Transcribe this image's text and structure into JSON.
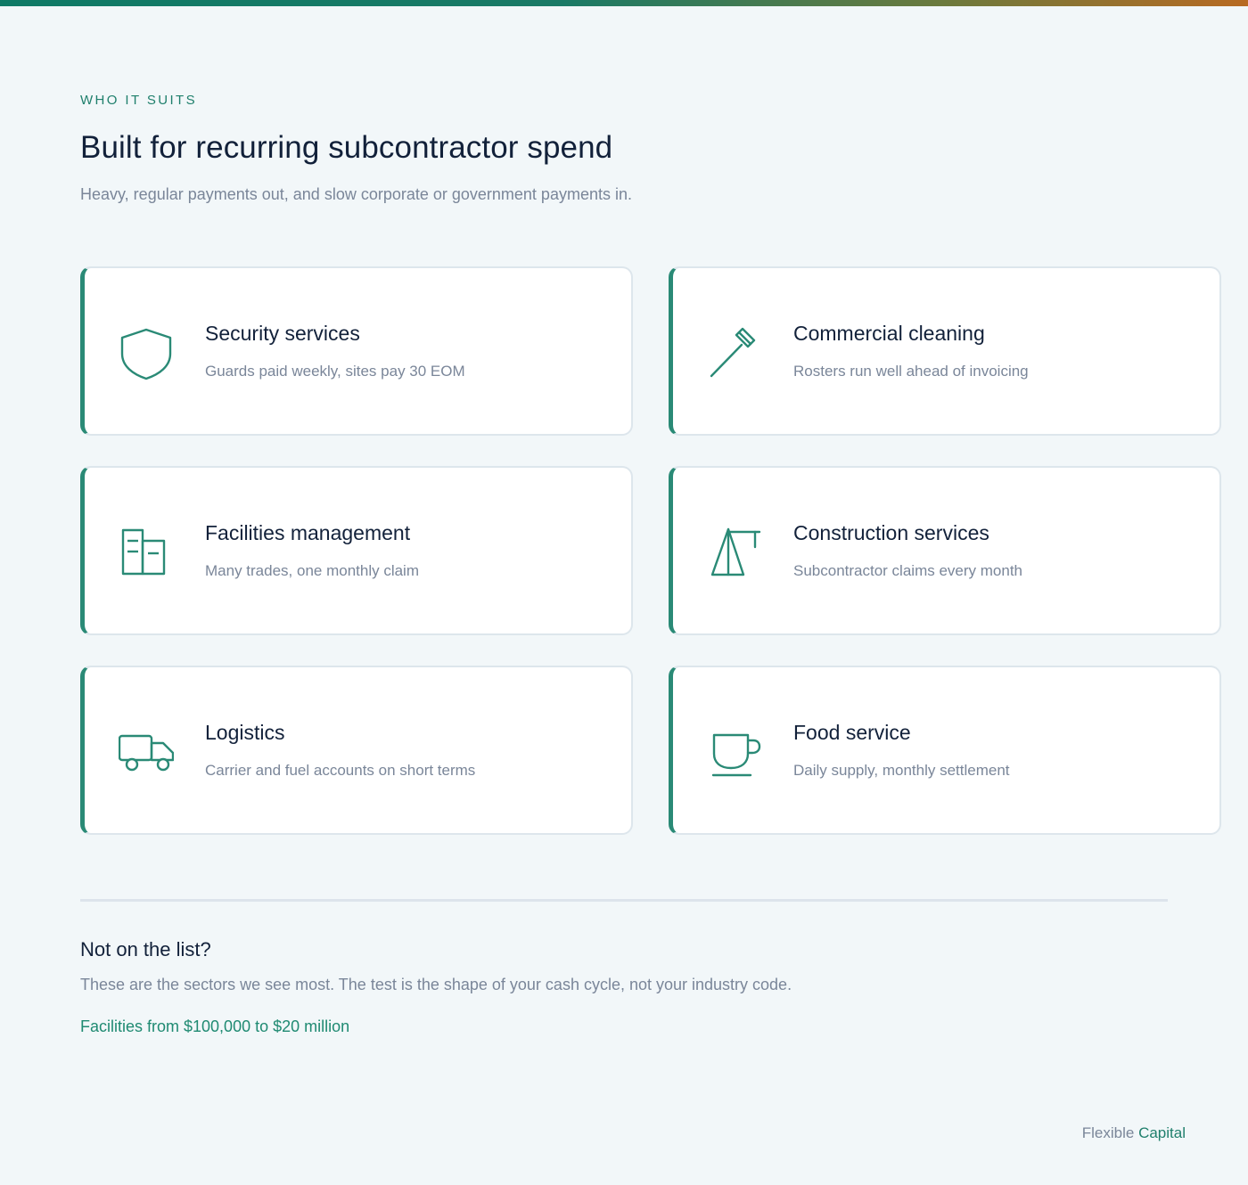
{
  "eyebrow": "WHO IT SUITS",
  "title": "Built for recurring subcontractor spend",
  "subtitle": "Heavy, regular payments out, and slow corporate or government payments in.",
  "cards": [
    {
      "title": "Security services",
      "desc": "Guards paid weekly, sites pay 30 EOM",
      "icon": "shield-icon"
    },
    {
      "title": "Commercial cleaning",
      "desc": "Rosters run well ahead of invoicing",
      "icon": "mop-icon"
    },
    {
      "title": "Facilities management",
      "desc": "Many trades, one monthly claim",
      "icon": "building-icon"
    },
    {
      "title": "Construction services",
      "desc": "Subcontractor claims every month",
      "icon": "crane-icon"
    },
    {
      "title": "Logistics",
      "desc": "Carrier and fuel accounts on short terms",
      "icon": "truck-icon"
    },
    {
      "title": "Food service",
      "desc": "Daily supply, monthly settlement",
      "icon": "cup-icon"
    }
  ],
  "not_on_list": {
    "title": "Not on the list?",
    "text": "These are the sectors we see most. The test is the shape of your cash cycle, not your industry code.",
    "facilities": "Facilities from $100,000 to $20 million"
  },
  "brand": {
    "part1": "Flexible",
    "part2": "Capital"
  },
  "colors": {
    "accent": "#2a8a76",
    "heading": "#12213a",
    "muted": "#7a8699",
    "background": "#f2f7f9"
  }
}
